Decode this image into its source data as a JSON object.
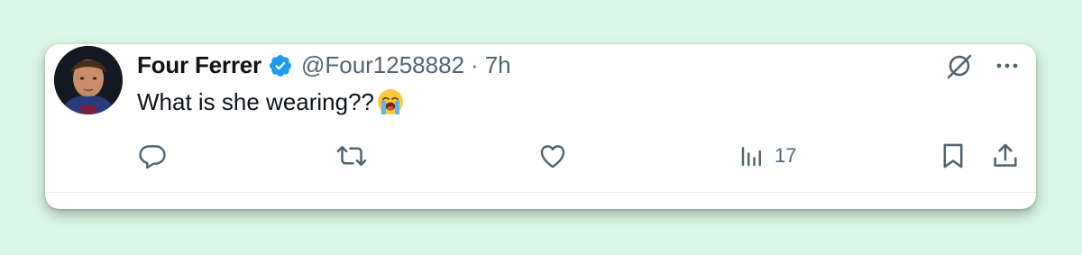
{
  "tweet": {
    "display_name": "Four Ferrer",
    "handle": "@Four1258882",
    "separator": "·",
    "time": "7h",
    "text": "What is she wearing??",
    "emoji": "loudly-crying-face"
  },
  "actions": {
    "views_count": "17"
  },
  "colors": {
    "background": "#d9f7e4",
    "text_primary": "#0f1419",
    "text_secondary": "#536471",
    "verified_blue": "#1d9bf0"
  },
  "icons": [
    "reply-icon",
    "retweet-icon",
    "like-icon",
    "views-icon",
    "bookmark-icon",
    "share-icon",
    "grok-icon",
    "more-icon",
    "verified-badge-icon"
  ]
}
